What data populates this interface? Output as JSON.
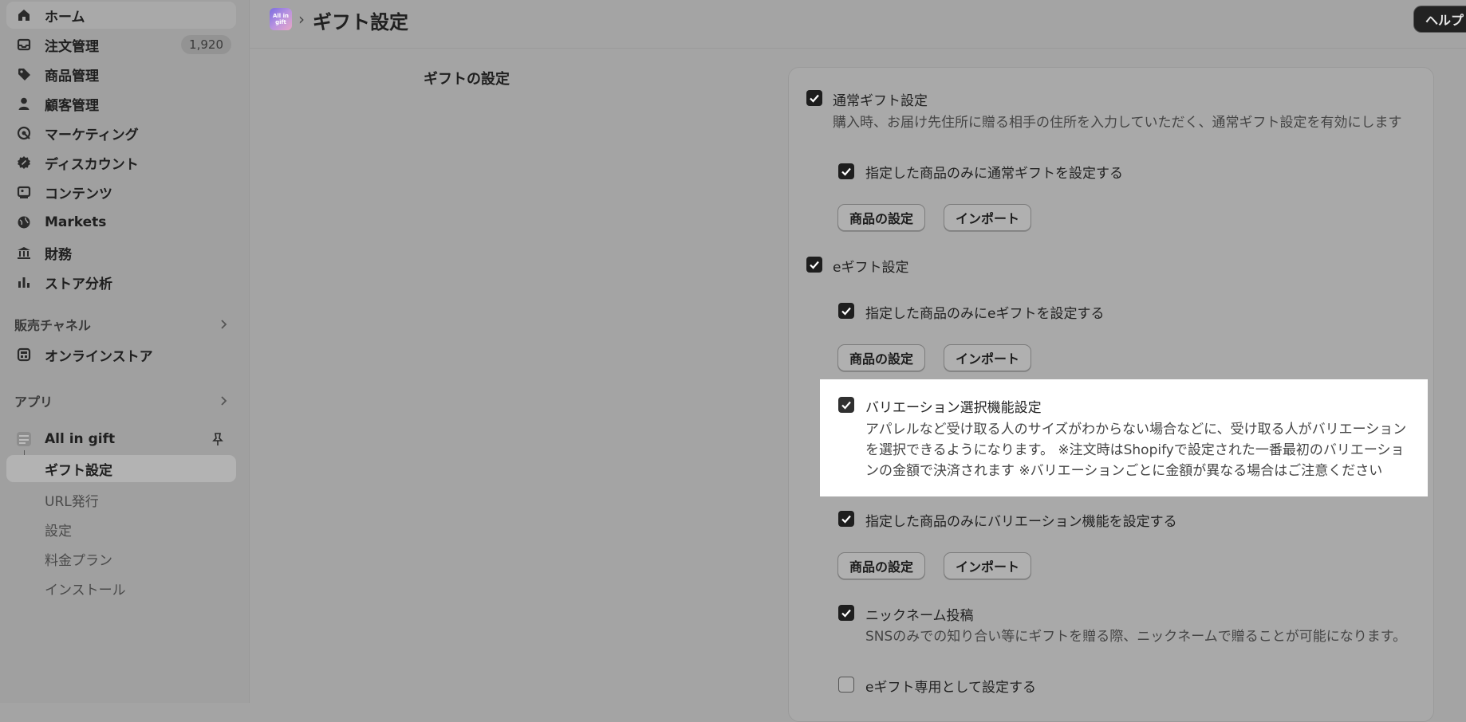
{
  "sidebar": {
    "items": [
      {
        "label": "ホーム",
        "icon": "home-icon"
      },
      {
        "label": "注文管理",
        "icon": "inbox-icon",
        "badge": "1,920"
      },
      {
        "label": "商品管理",
        "icon": "tag-icon"
      },
      {
        "label": "顧客管理",
        "icon": "person-icon"
      },
      {
        "label": "マーケティング",
        "icon": "target-icon"
      },
      {
        "label": "ディスカウント",
        "icon": "discount-icon"
      },
      {
        "label": "コンテンツ",
        "icon": "content-icon"
      },
      {
        "label": "Markets",
        "icon": "globe-icon"
      },
      {
        "label": "財務",
        "icon": "bank-icon"
      },
      {
        "label": "ストア分析",
        "icon": "bar-chart-icon"
      }
    ],
    "sales_channels": {
      "title": "販売チャネル",
      "items": [
        {
          "label": "オンラインストア",
          "icon": "store-icon"
        }
      ]
    },
    "apps": {
      "title": "アプリ",
      "app_name": "All in gift",
      "sub_items": [
        {
          "label": "ギフト設定"
        },
        {
          "label": "URL発行"
        },
        {
          "label": "設定"
        },
        {
          "label": "料金プラン"
        },
        {
          "label": "インストール"
        }
      ]
    }
  },
  "header": {
    "logo_text": "All in gift",
    "title": "ギフト設定",
    "help_label": "ヘルプ"
  },
  "main": {
    "section_title": "ギフトの設定",
    "options": {
      "normal_gift": {
        "label": "通常ギフト設定",
        "checked": true,
        "desc": "購入時、お届け先住所に贈る相手の住所を入力していただく、通常ギフト設定を有効にします"
      },
      "normal_limit": {
        "label": "指定した商品のみに通常ギフトを設定する",
        "checked": true
      },
      "egift": {
        "label": "eギフト設定",
        "checked": true
      },
      "egift_limit": {
        "label": "指定した商品のみにeギフトを設定する",
        "checked": true
      },
      "variation": {
        "label": "バリエーション選択機能設定",
        "checked": true,
        "desc1": "アパレルなど受け取る人のサイズがわからない場合などに、受け取る人がバリエーション",
        "desc2": "を選択できるようになります。 ※注文時はShopifyで設定された一番最初のバリエーショ",
        "desc3": "ンの金額で決済されます ※バリエーションごとに金額が異なる場合はご注意ください"
      },
      "variation_limit": {
        "label": "指定した商品のみにバリエーション機能を設定する",
        "checked": true
      },
      "nickname": {
        "label": "ニックネーム投稿",
        "checked": true,
        "desc": "SNSのみでの知り合い等にギフトを贈る際、ニックネームで贈ることが可能になります。"
      },
      "egift_only": {
        "label": "eギフト専用として設定する",
        "checked": false
      }
    },
    "buttons": {
      "product_settings": "商品の設定",
      "import": "インポート"
    }
  }
}
